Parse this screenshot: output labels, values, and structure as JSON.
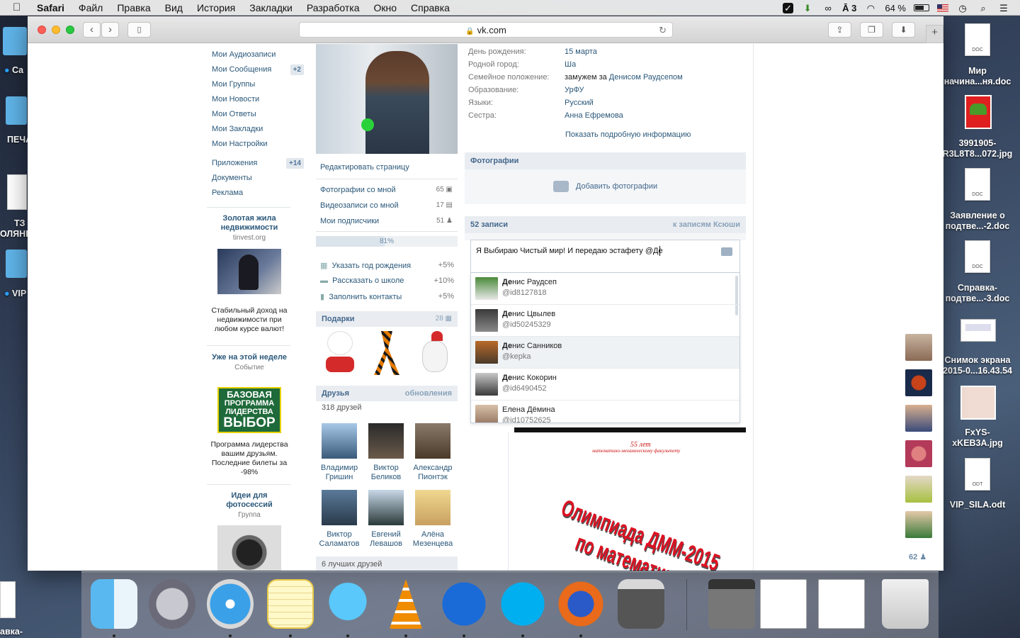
{
  "menubar": {
    "app": "Safari",
    "items": [
      "Файл",
      "Правка",
      "Вид",
      "История",
      "Закладки",
      "Разработка",
      "Окно",
      "Справка"
    ],
    "battery": "64 %",
    "input_indicator": "3"
  },
  "browser": {
    "url": "vk.com"
  },
  "left_nav": {
    "items": [
      {
        "label": "Мои Аудиозаписи"
      },
      {
        "label": "Мои Сообщения",
        "badge": "+2"
      },
      {
        "label": "Мои Группы"
      },
      {
        "label": "Мои Новости"
      },
      {
        "label": "Мои Ответы"
      },
      {
        "label": "Мои Закладки"
      },
      {
        "label": "Мои Настройки"
      }
    ],
    "items2": [
      {
        "label": "Приложения",
        "badge": "+14"
      },
      {
        "label": "Документы"
      },
      {
        "label": "Реклама"
      }
    ]
  },
  "ads": [
    {
      "title": "Золотая жила недвижимости",
      "source": "tinvest.org",
      "desc": "Стабильный доход на недвижимости при любом курсе валют!"
    },
    {
      "title": "Уже на этой неделе",
      "source": "Событие",
      "banner": [
        "БАЗОВАЯ",
        "ПРОГРАММА",
        "ЛИДЕРСТВА",
        "ВЫБОР"
      ],
      "desc": "Программа лидерства вашим друзьям. Последние билеты за -98%"
    },
    {
      "title": "Идеи для фотосессий",
      "source": "Группа"
    }
  ],
  "profile": {
    "edit_label": "Редактировать страницу",
    "links": [
      {
        "label": "Фотографии со мной",
        "count": "65"
      },
      {
        "label": "Видеозаписи со мной",
        "count": "17"
      },
      {
        "label": "Мои подписчики",
        "count": "51"
      }
    ],
    "progress": {
      "label": "81%",
      "value": 0.81
    },
    "tasks": [
      {
        "label": "Указать год рождения",
        "pct": "+5%"
      },
      {
        "label": "Рассказать о школе",
        "pct": "+10%"
      },
      {
        "label": "Заполнить контакты",
        "pct": "+5%"
      }
    ],
    "gifts": {
      "title": "Подарки",
      "count": "28"
    },
    "friends": {
      "title": "Друзья",
      "updates": "обновления",
      "count_label": "318 друзей",
      "best_label": "6 лучших друзей",
      "list": [
        {
          "first": "Владимир",
          "last": "Гришин"
        },
        {
          "first": "Виктор",
          "last": "Беликов"
        },
        {
          "first": "Александр",
          "last": "Пионтэк"
        },
        {
          "first": "Виктор",
          "last": "Саламатов"
        },
        {
          "first": "Евгений",
          "last": "Левашов"
        },
        {
          "first": "Алёна",
          "last": "Мезенцева"
        }
      ]
    }
  },
  "info": {
    "rows": [
      {
        "label": "День рождения:",
        "value": "15 марта"
      },
      {
        "label": "Родной город:",
        "value": "Ша"
      },
      {
        "label": "Семейное положение:",
        "value_plain": "замужем за ",
        "value": "Денисом Раудсепом"
      },
      {
        "label": "Образование:",
        "value": "УрФУ"
      },
      {
        "label": "Языки:",
        "value": "Русский"
      },
      {
        "label": "Сестра:",
        "value": "Анна Ефремова"
      }
    ],
    "more": "Показать подробную информацию"
  },
  "photos": {
    "title": "Фотографии",
    "add": "Добавить фотографии"
  },
  "wall": {
    "count": "52 записи",
    "link": "к записям Ксюши",
    "composer_text": "Я Выбираю Чистый мир! И передаю эстафету @Де",
    "suggestions": [
      {
        "bold": "Де",
        "rest": "нис Раудсеп",
        "id": "@id8127818"
      },
      {
        "bold": "Де",
        "rest": "нис Цвылев",
        "id": "@id50245329"
      },
      {
        "bold": "Де",
        "rest": "нис Санников",
        "id": "@kepka"
      },
      {
        "bold": "Де",
        "rest": "нис Кокорин",
        "id": "@id6490452"
      },
      {
        "bold": "",
        "rest": "Елена Дёмина",
        "id": "@id10752625"
      }
    ],
    "poster": {
      "small": "55 лет",
      "sub": "математико-механическому факультету",
      "line1": "Олимпиада ДММ-2015",
      "line2": "по математике"
    }
  },
  "side_online": {
    "count": "62"
  },
  "desktop_icons": [
    {
      "name": "Мир начина...ня.doc",
      "type": "DOC"
    },
    {
      "name": "3991905-R3L8T8...072.jpg",
      "type": "img"
    },
    {
      "name": "Заявление о подтве...-2.doc",
      "type": "DOC"
    },
    {
      "name": "Справка-подтве...-3.doc",
      "type": "DOC"
    },
    {
      "name": "Снимок экрана 2015-0...16.43.54",
      "type": "img"
    },
    {
      "name": "FxYS-xKEB3A.jpg",
      "type": "img"
    },
    {
      "name": "VIP_SILA.odt",
      "type": "ODT"
    }
  ],
  "left_desktop_labels": [
    "Ca",
    "ПЕЧА",
    "ТЗ",
    "ОЛЯНК",
    "VIP",
    "авка-"
  ],
  "dock_apps": [
    "finder",
    "launchpad",
    "safari",
    "notes",
    "messages",
    "vlc",
    "openoffice",
    "skype",
    "firefox",
    "calculator",
    "calculator2",
    "doc-window",
    "doc-window2",
    "trash"
  ],
  "colors": {
    "vk_link": "#2b587a",
    "vk_header": "#45688e",
    "vk_bar": "#e9edf1"
  }
}
